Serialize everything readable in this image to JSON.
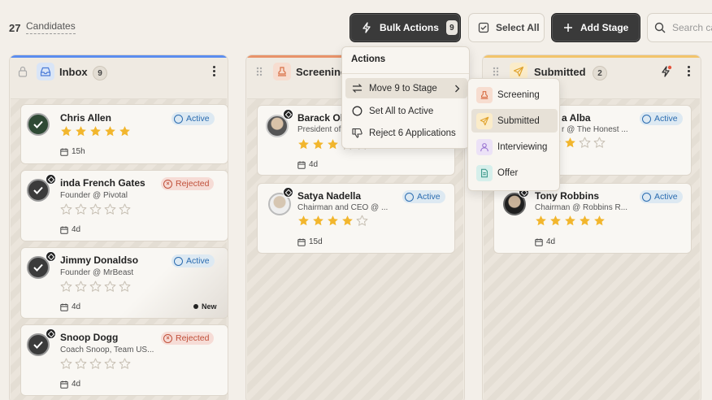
{
  "header": {
    "count": "27",
    "count_label": "Candidates",
    "bulk_actions_label": "Bulk Actions",
    "bulk_actions_badge": "9",
    "select_all_label": "Select All",
    "add_stage_label": "Add Stage",
    "search_placeholder": "Search ca"
  },
  "columns": [
    {
      "title": "Inbox",
      "count": "9",
      "accent": "#5b8def"
    },
    {
      "title": "Screening",
      "count": "",
      "accent": "#e8936a"
    },
    {
      "title": "Submitted",
      "count": "2",
      "accent": "#f2c46b"
    }
  ],
  "inbox_cards": [
    {
      "name": "Chris Allen",
      "role": "",
      "status": "Active",
      "rating": 5,
      "age": "15h"
    },
    {
      "name": "inda French Gates",
      "role": "Founder @ Pivotal",
      "status": "Rejected",
      "rating": 0,
      "age": "4d"
    },
    {
      "name": "Jimmy Donaldso",
      "role": "Founder @ MrBeast",
      "status": "Active",
      "rating": 0,
      "age": "4d",
      "tag": "New"
    },
    {
      "name": "Snoop Dogg",
      "role": "Coach Snoop, Team US...",
      "status": "Rejected",
      "rating": 0,
      "age": "4d"
    }
  ],
  "screening_cards": [
    {
      "name": "Barack Ob",
      "role": "President of",
      "status": "",
      "rating": 3,
      "age": "4d"
    },
    {
      "name": "Satya Nadella",
      "role": "Chairman and CEO @ ...",
      "status": "Active",
      "rating": 4,
      "age": "15d"
    }
  ],
  "submitted_cards": [
    {
      "name": "a Alba",
      "role": "r @ The Honest ...",
      "status": "Active",
      "rating": 3,
      "age": ""
    },
    {
      "name": "Tony Robbins",
      "role": "Chairman @ Robbins R...",
      "status": "Active",
      "rating": 5,
      "age": "4d"
    }
  ],
  "actions_menu": {
    "title": "Actions",
    "items": [
      {
        "label": "Move 9 to Stage"
      },
      {
        "label": "Set All to Active"
      },
      {
        "label": "Reject 6 Applications"
      }
    ]
  },
  "stage_submenu": {
    "items": [
      {
        "label": "Screening",
        "color": "#e8936a"
      },
      {
        "label": "Submitted",
        "color": "#f2c46b"
      },
      {
        "label": "Interviewing",
        "color": "#a98ad8"
      },
      {
        "label": "Offer",
        "color": "#5fb3a6"
      }
    ]
  },
  "colors": {
    "star": "#f2b62d",
    "star_empty": "#c9c2b6",
    "active": "#2b6cb0",
    "rejected": "#c0503a"
  }
}
